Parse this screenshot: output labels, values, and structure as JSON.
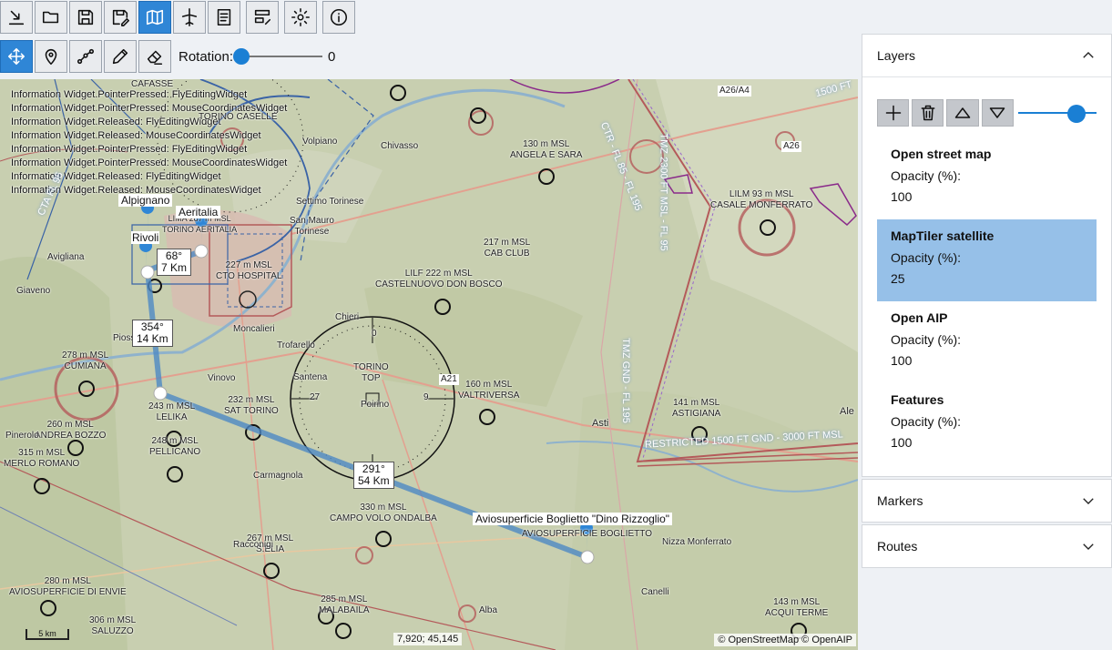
{
  "toolbar": {
    "main_buttons": [
      "import-icon",
      "open-icon",
      "save-icon",
      "save-as-icon",
      "map-icon",
      "plane-icon",
      "checklist-icon",
      "route-edit-icon",
      "settings-icon",
      "info-icon"
    ],
    "map_tools": [
      "pan-icon",
      "marker-icon",
      "route-icon",
      "pencil-icon",
      "eraser-icon"
    ],
    "rotation_label": "Rotation:",
    "rotation_value": "0"
  },
  "map": {
    "log_lines": [
      "Information Widget.PointerPressed: FlyEditingWidget",
      "Information Widget.PointerPressed: MouseCoordinatesWidget",
      "Information Widget.Released: FlyEditingWidget",
      "Information Widget.Released: MouseCoordinatesWidget",
      "Information Widget.PointerPressed: FlyEditingWidget",
      "Information Widget.PointerPressed: MouseCoordinatesWidget",
      "Information Widget.Released: FlyEditingWidget",
      "Information Widget.Released: MouseCoordinatesWidget"
    ],
    "pins": {
      "alpignano": "Alpignano",
      "aeritalia": "Aeritalia",
      "rivoli": "Rivoli",
      "boglietto": "Aviosuperficie Boglietto \"Dino Rizzoglio\""
    },
    "legs": [
      {
        "heading": "68°",
        "distance": "7 Km"
      },
      {
        "heading": "354°",
        "distance": "14 Km"
      },
      {
        "heading": "291°",
        "distance": "54 Km"
      }
    ],
    "labels": {
      "angela": "130 m MSL\nANGELA E SARA",
      "casale": "LILM 93 m MSL\nCASALE MONFERRATO",
      "cab": "217 m MSL\nCAB CLUB",
      "castelnuovo": "LILF 222 m MSL\nCASTELNUOVO DON BOSCO",
      "hospital": "227 m MSL\nCTO HOSPITAL",
      "torino_top": "TORINO\nTOP",
      "valtriversa": "160 m MSL\nVALTRIVERSA",
      "astigiana": "141 m MSL\nASTIGIANA",
      "cumiana": "278 m MSL\nCUMIANA",
      "lelika": "243 m MSL\nLELIKA",
      "sat_torino": "232 m MSL\nSAT TORINO",
      "andrea": "260 m MSL\nANDREA BOZZO",
      "pellicano": "248 m MSL\nPELLICANO",
      "merlo": "315 m MSL\nMERLO ROMANO",
      "campo_volo": "330 m MSL\nCAMPO VOLO ONDALBA",
      "boglietto_field": "AVIOSUPERFICIE BOGLIETTO",
      "selia": "267 m MSL\nS.ELIA",
      "envie": "280 m MSL\nAVIOSUPERFICIE DI ENVIE",
      "malabaila": "285 m MSL\nMALABAILA",
      "saluzzo": "306 m MSL\nSALUZZO",
      "acqui": "143 m MSL\nACQUI TERME",
      "lima": "LIMA 287 m MSL\nTORINO AERITALIA",
      "chivasso": "Chivasso",
      "volpiano": "Volpiano",
      "asti": "Asti",
      "chieri": "Chieri",
      "carmagnola": "Carmagnola",
      "alba": "Alba",
      "racconigi": "Racconigi",
      "nizza": "Nizza Monferrato",
      "canelli": "Canelli",
      "pinerolo": "Pinerolo",
      "piossasco": "Piossasco",
      "avigliana": "Avigliana",
      "giaveno": "Giaveno",
      "santena": "Santena",
      "poirino": "Poirino",
      "vinovo": "Vinovo",
      "moncalieri": "Moncalieri",
      "trofarello": "Trofarello",
      "san_mauro": "San Mauro\nTorinese",
      "settimo": "Settimo Torinese",
      "ctr_fl85": "CTR - FL 85 - FL 195",
      "tmz": "TMZ 2300 FT MSL - FL 95",
      "tmz_gnd": "TMZ GND - FL 195",
      "restricted": "RESTRICTED 1500 FT GND - 3000 FT MSL",
      "cta_fl": "CTA FL 95",
      "top_right": "1500 FT",
      "a26": "A26",
      "a26a4": "A26/A4",
      "a21": "A21",
      "ale": "Ale",
      "cafasse": "CAFASSE",
      "torino_caselle": "TORINO CASELLE",
      "compass_n": "0",
      "compass_e": "9",
      "compass_w": "27"
    },
    "scale_label": "5 km",
    "coordinates": "7,920; 45,145",
    "attribution": "© OpenStreetMap © OpenAIP"
  },
  "panel": {
    "layers_title": "Layers",
    "markers_title": "Markers",
    "routes_title": "Routes",
    "opacity_slider_value": 0.73,
    "layers": [
      {
        "name": "Open street map",
        "opacity_label": "Opacity (%):",
        "opacity": "100",
        "selected": false
      },
      {
        "name": "MapTiler satellite",
        "opacity_label": "Opacity (%):",
        "opacity": "25",
        "selected": true
      },
      {
        "name": "Open AIP",
        "opacity_label": "Opacity (%):",
        "opacity": "100",
        "selected": false
      },
      {
        "name": "Features",
        "opacity_label": "Opacity (%):",
        "opacity": "100",
        "selected": false
      }
    ]
  },
  "colors": {
    "accent": "#2f86d6",
    "selected_layer": "#96c0e8",
    "route": "#4d88c4",
    "airspace": "#b45a5a"
  }
}
